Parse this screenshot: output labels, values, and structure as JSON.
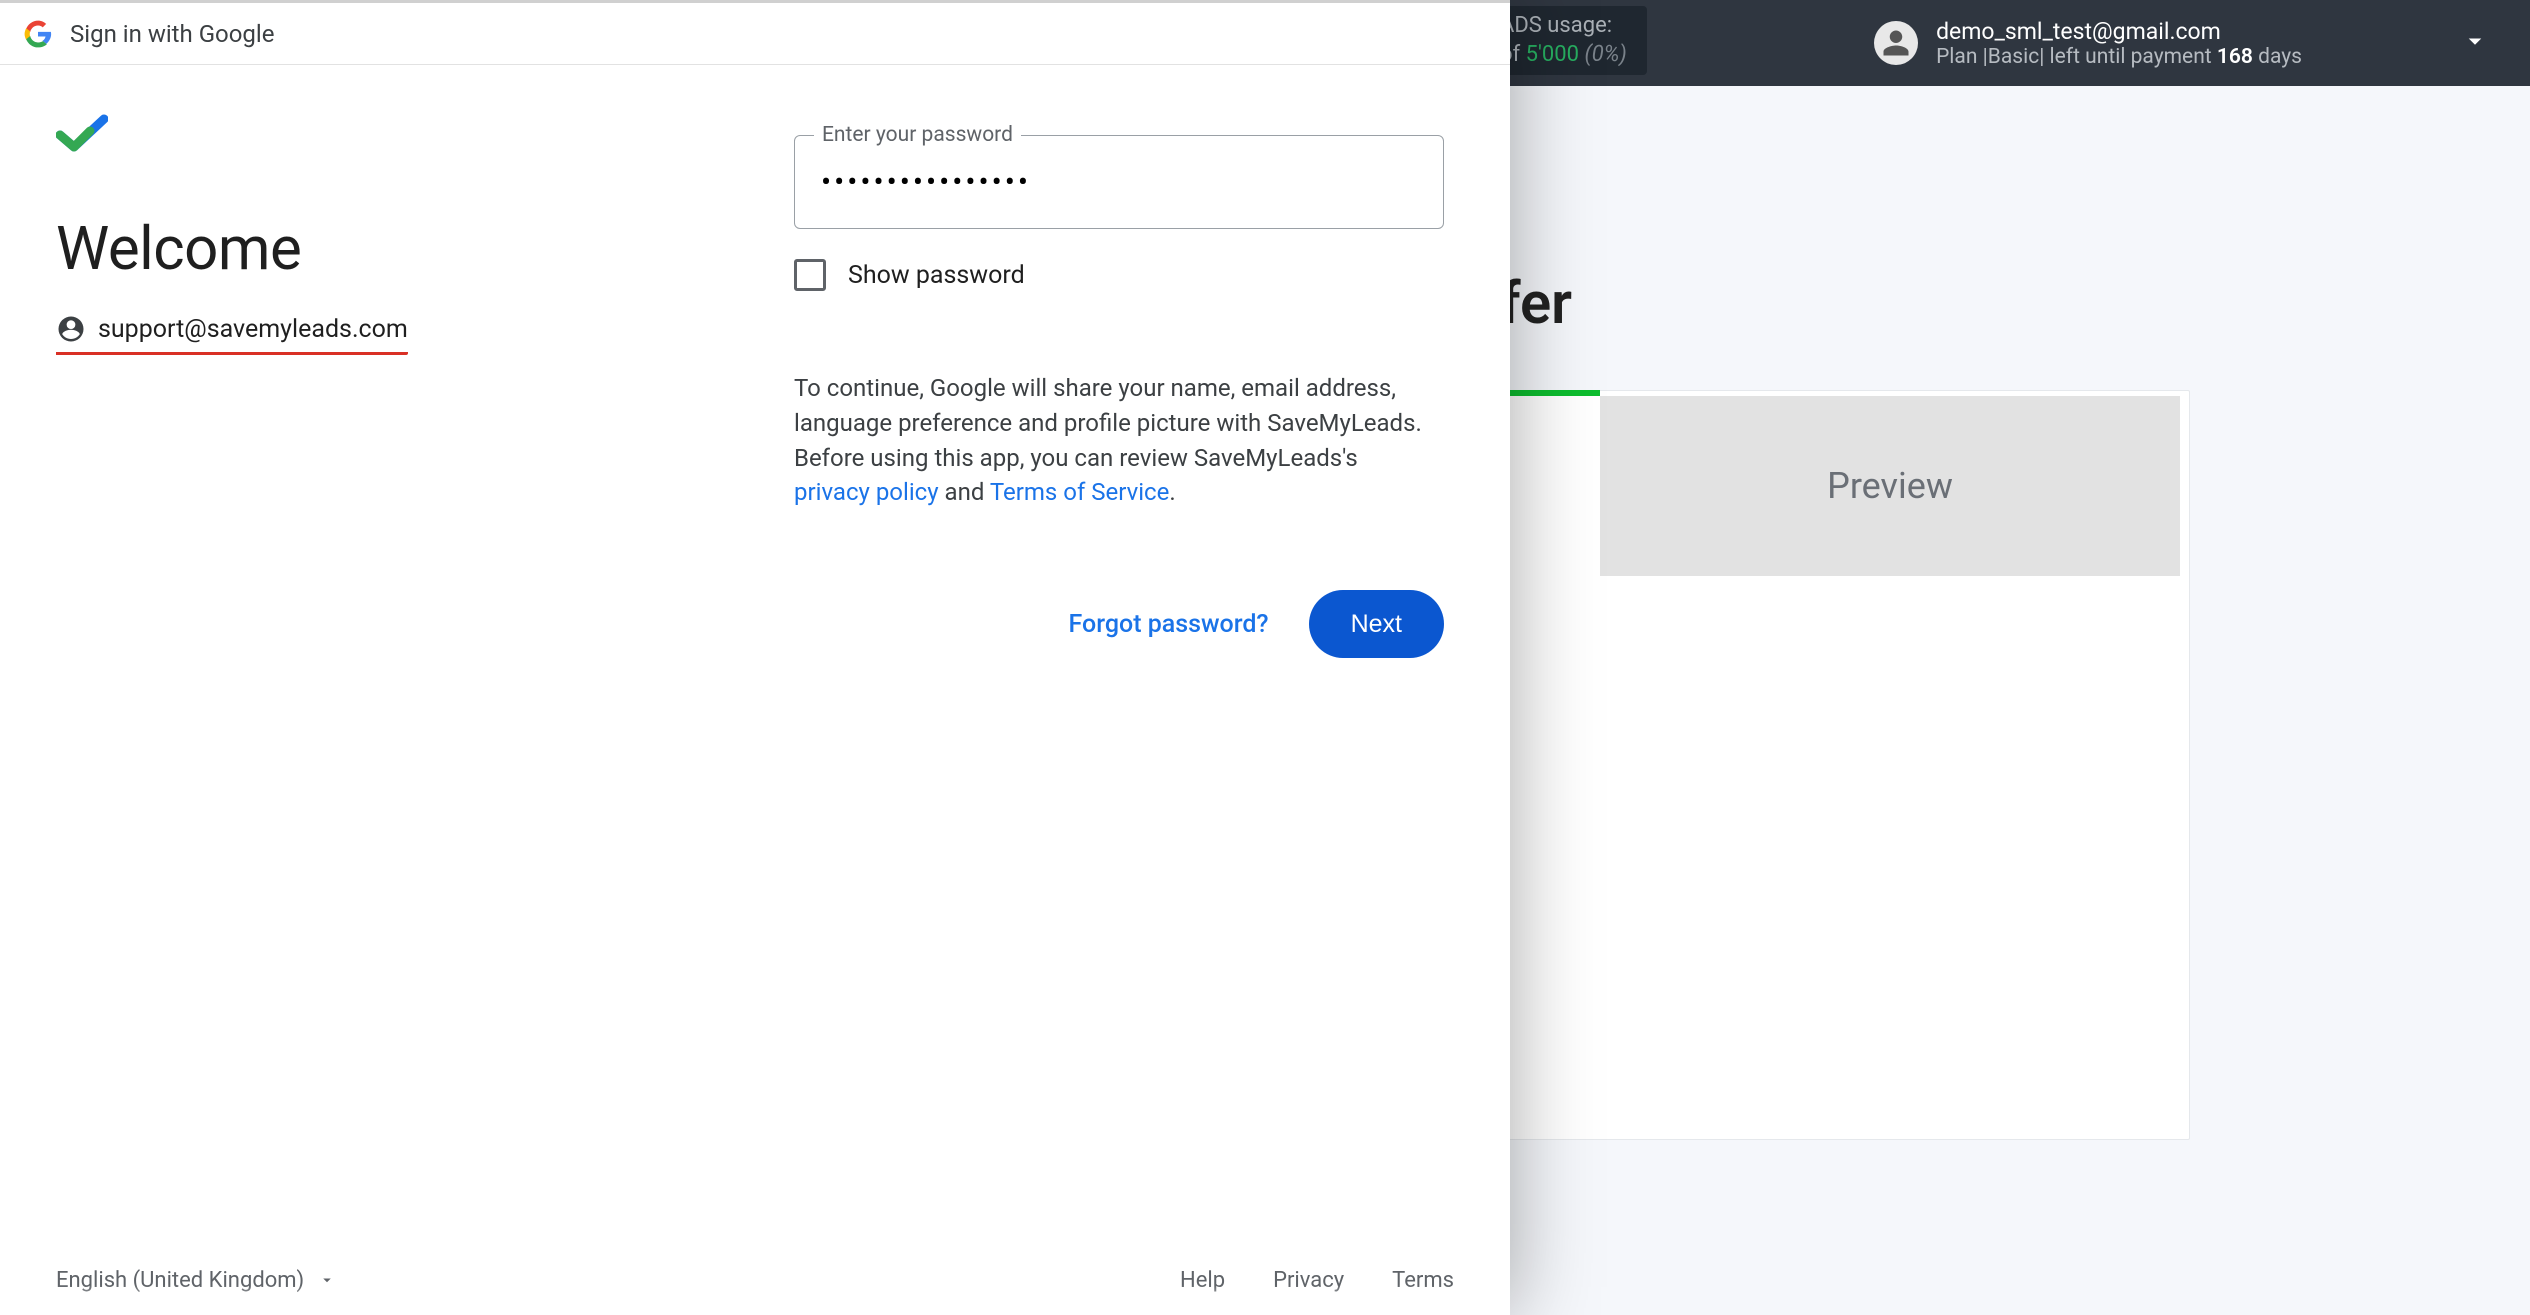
{
  "bg": {
    "usage_label": "ADS usage:",
    "usage_of": "of",
    "usage_limit": "5'000",
    "usage_pct": "(0%)",
    "account_email": "demo_sml_test@gmail.com",
    "account_plan_prefix": "Plan |Basic| left until payment",
    "account_days": "168",
    "account_days_word": "days",
    "page_heading": "fer",
    "preview_label": "Preview"
  },
  "google": {
    "header": "Sign in with Google",
    "welcome": "Welcome",
    "email": "support@savemyleads.com",
    "password_label": "Enter your password",
    "password_value": "••••••••••••••••",
    "show_password": "Show password",
    "consent_part1": "To continue, Google will share your name, email address, language preference and profile picture with SaveMyLeads. Before using this app, you can review SaveMyLeads's ",
    "privacy": "privacy policy",
    "and": " and ",
    "tos": "Terms of Service",
    "period": ".",
    "forgot": "Forgot password?",
    "next": "Next",
    "footer": {
      "language": "English (United Kingdom)",
      "help": "Help",
      "privacy": "Privacy",
      "terms": "Terms"
    }
  }
}
